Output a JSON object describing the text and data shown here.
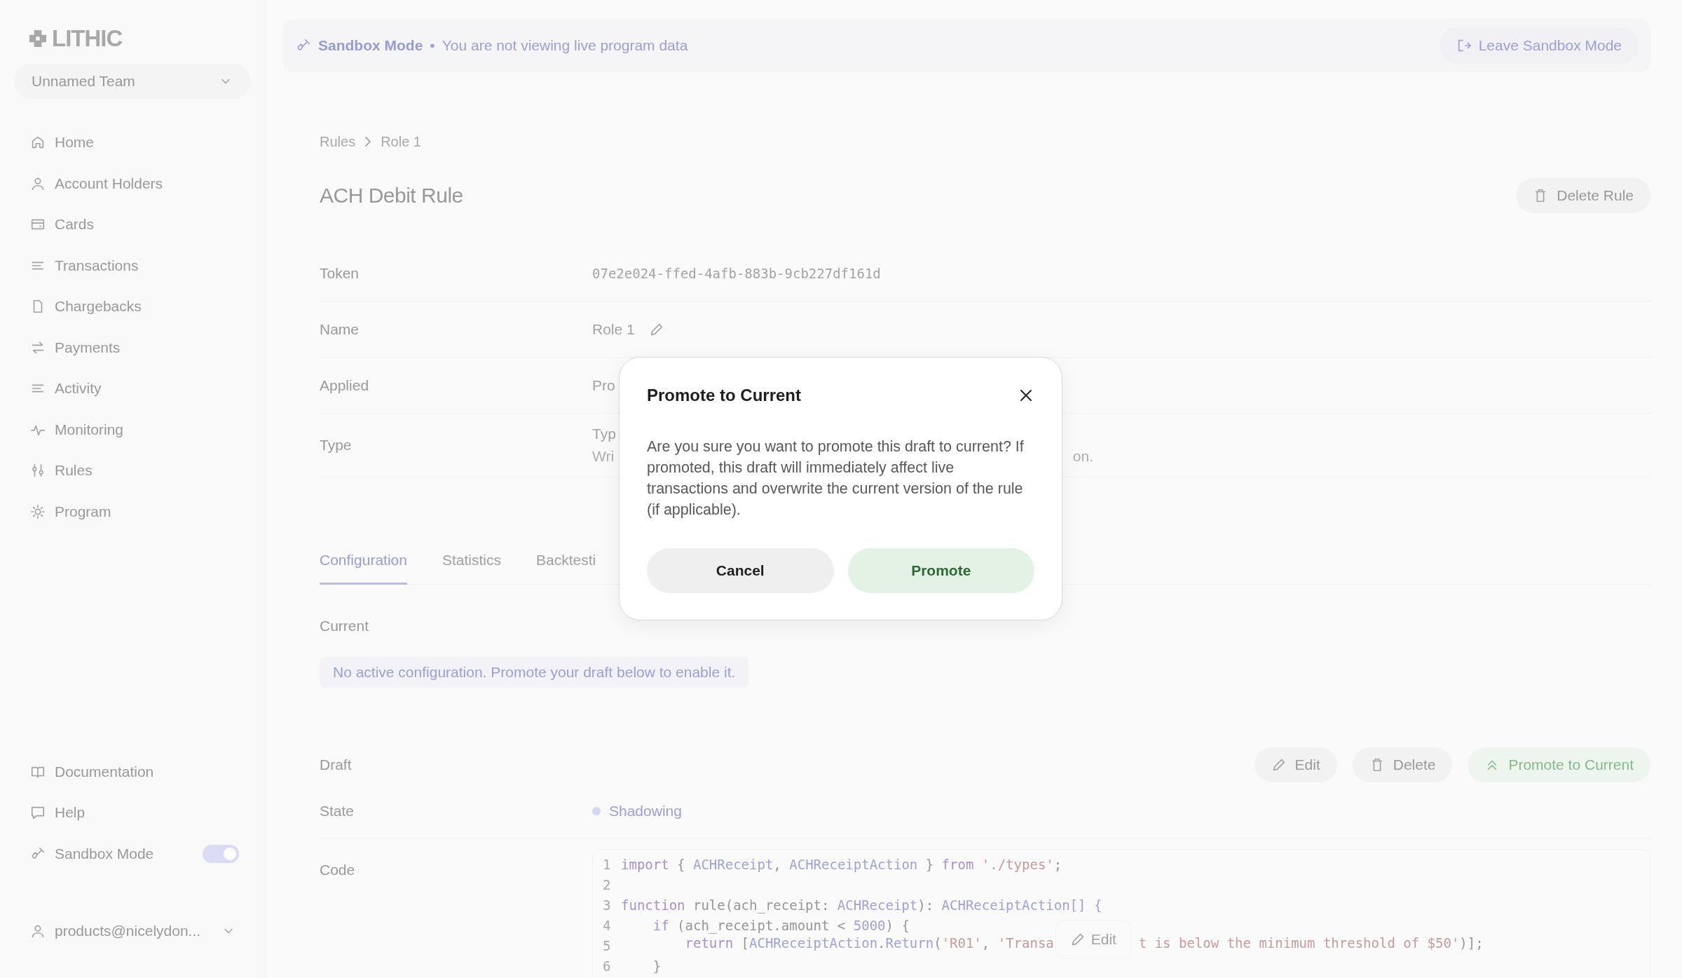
{
  "sidebar": {
    "logo": "LITHIC",
    "team": "Unnamed Team",
    "nav": [
      {
        "label": "Home"
      },
      {
        "label": "Account Holders"
      },
      {
        "label": "Cards"
      },
      {
        "label": "Transactions"
      },
      {
        "label": "Chargebacks"
      },
      {
        "label": "Payments"
      },
      {
        "label": "Activity"
      },
      {
        "label": "Monitoring"
      },
      {
        "label": "Rules"
      },
      {
        "label": "Program"
      }
    ],
    "footer": [
      {
        "label": "Documentation",
        "kind": "link"
      },
      {
        "label": "Help",
        "kind": "link"
      },
      {
        "label": "Sandbox Mode",
        "kind": "toggle",
        "on": true
      }
    ],
    "user": "products@nicelydon..."
  },
  "banner": {
    "title": "Sandbox Mode",
    "separator": "•",
    "message": "You are not viewing live program data",
    "button": "Leave Sandbox Mode"
  },
  "breadcrumb": [
    "Rules",
    "Role 1"
  ],
  "title": "ACH Debit Rule",
  "delete_button": "Delete Rule",
  "details": [
    {
      "label": "Token",
      "value": "07e2e024-ffed-4afb-883b-9cb227df161d",
      "kind": "mono"
    },
    {
      "label": "Name",
      "value": "Role 1",
      "kind": "editable"
    },
    {
      "label": "Applied",
      "value": "Pro",
      "kind": "text"
    },
    {
      "label": "Type",
      "value": "Typ",
      "note": "Wri",
      "note_end": "on.",
      "kind": "text"
    }
  ],
  "tabs": [
    {
      "label": "Configuration",
      "selected": true
    },
    {
      "label": "Statistics",
      "selected": false
    },
    {
      "label": "Backtesti",
      "selected": false
    }
  ],
  "current": {
    "label": "Current",
    "message": "No active configuration. Promote your draft below to enable it."
  },
  "draft": {
    "label": "Draft",
    "buttons": [
      {
        "label": "Edit",
        "kind": "edit"
      },
      {
        "label": "Delete",
        "kind": "delete"
      },
      {
        "label": "Promote to Current",
        "kind": "promote"
      }
    ],
    "state": {
      "label": "State",
      "value": "Shadowing",
      "color": "#d6d8f2"
    },
    "code": {
      "label": "Code",
      "edit_button": "Edit",
      "lines": [
        {
          "number": "1",
          "tokens": [
            {
              "kind": "keyword",
              "text": "import"
            },
            {
              "kind": "plain",
              "text": " { "
            },
            {
              "kind": "type",
              "text": "ACHReceipt"
            },
            {
              "kind": "plain",
              "text": ", "
            },
            {
              "kind": "type",
              "text": "ACHReceiptAction"
            },
            {
              "kind": "plain",
              "text": " } "
            },
            {
              "kind": "keyword",
              "text": "from"
            },
            {
              "kind": "string",
              "text": " './types'"
            },
            {
              "kind": "plain",
              "text": ";"
            }
          ]
        },
        {
          "number": "2"
        },
        {
          "number": "3",
          "tokens": [
            {
              "kind": "keyword",
              "text": "function"
            },
            {
              "kind": "plain",
              "text": " rule(ach_receipt: "
            },
            {
              "kind": "type",
              "text": "ACHReceipt"
            },
            {
              "kind": "plain",
              "text": "): "
            },
            {
              "kind": "type",
              "text": "ACHReceiptAction[] {"
            }
          ]
        },
        {
          "number": "4",
          "tokens": [
            {
              "kind": "keyword",
              "text": "    if"
            },
            {
              "kind": "plain",
              "text": " (ach_receipt.amount < "
            },
            {
              "kind": "number",
              "text": "5000"
            },
            {
              "kind": "plain",
              "text": ") {"
            }
          ]
        },
        {
          "number": "5",
          "tokens": [
            {
              "kind": "keyword",
              "text": "        return"
            },
            {
              "kind": "plain",
              "text": " ["
            },
            {
              "kind": "type",
              "text": "ACHReceiptAction"
            },
            {
              "kind": "plain",
              "text": "."
            },
            {
              "kind": "type",
              "text": "Return"
            },
            {
              "kind": "plain",
              "text": "("
            },
            {
              "kind": "string",
              "text": "'R01'"
            },
            {
              "kind": "plain",
              "text": ", "
            },
            {
              "kind": "string",
              "text": "'Transa"
            }
          ],
          "tokens_after": [
            {
              "kind": "string",
              "text": "t is below the minimum threshold of $50'"
            },
            {
              "kind": "plain",
              "text": ")];"
            }
          ]
        },
        {
          "number": "6",
          "tokens": [
            {
              "kind": "plain",
              "text": "    }"
            }
          ]
        }
      ]
    }
  },
  "modal": {
    "title": "Promote to Current",
    "body": "Are you sure you want to promote this draft to current? If promoted, this draft will immediately affect live transactions and overwrite the current version of the rule (if applicable).",
    "buttons": [
      {
        "label": "Cancel",
        "kind": "neutral"
      },
      {
        "label": "Promote",
        "kind": "primary"
      }
    ]
  }
}
